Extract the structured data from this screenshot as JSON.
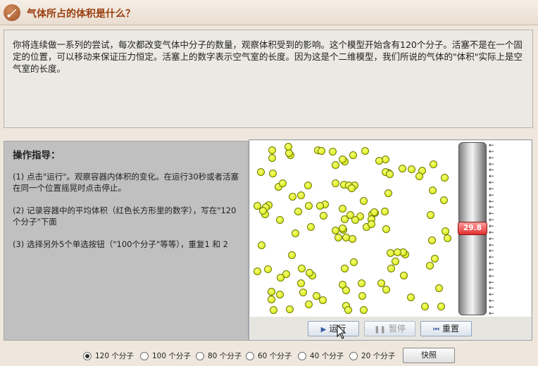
{
  "header": {
    "title": "气体所占的体积是什么？",
    "icon": "brush-icon"
  },
  "intro": {
    "text": "你将连续做一系列的尝试，每次都改变气体中分子的数量，观察体积受到的影响。这个模型开始含有120个分子。活塞不是在一个固定的位置，可以移动来保证压力恒定。活塞上的数字表示空气室的长度。因为这是个二维模型，我们所说的气体的\"体积\"实际上是空气室的长度。"
  },
  "instructions": {
    "heading": "操作指导：",
    "steps": [
      "(1) 点击\"运行\"。观察容器内体积的变化。在运行30秒或者活塞在同一个位置摇晃时点击停止。",
      "(2) 记录容器中的平均体积（红色长方形里的数字），写在\"120个分子\"下面",
      "(3) 选择另外5个单选按钮（\"100个分子\"等等），重复1 和 2"
    ]
  },
  "simulation": {
    "piston_value": "29.8",
    "arrows": "←",
    "colors": {
      "molecule": "#d5e800",
      "gauge": "#e23030"
    }
  },
  "controls": {
    "run": "运行",
    "pause": "暂停",
    "reset": "重置"
  },
  "options": {
    "selected": "120 个分子",
    "items": [
      "120 个分子",
      "100 个分子",
      "80 个分子",
      "60 个分子",
      "40 个分子",
      "20 个分子"
    ],
    "snapshot": "快照"
  }
}
